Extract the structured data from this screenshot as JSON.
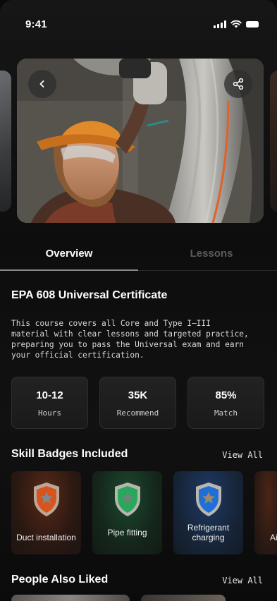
{
  "status_bar": {
    "time": "9:41"
  },
  "hero": {
    "back_icon": "chevron-left-icon",
    "share_icon": "share-icon"
  },
  "tabs": [
    {
      "label": "Overview",
      "active": true
    },
    {
      "label": "Lessons",
      "active": false
    }
  ],
  "course": {
    "title": "EPA 608 Universal Certificate",
    "description": "This course covers all Core and Type I–III material with clear lessons and targeted practice, preparing you to pass the Universal exam and earn your official certification."
  },
  "stats": [
    {
      "value": "10-12",
      "label": "Hours"
    },
    {
      "value": "35K",
      "label": "Recommend"
    },
    {
      "value": "85%",
      "label": "Match"
    }
  ],
  "skill_badges": {
    "title": "Skill Badges Included",
    "view_all": "View All",
    "items": [
      {
        "label": "Duct installation",
        "color": "#d9541c"
      },
      {
        "label": "Pipe fitting",
        "color": "#27a85a"
      },
      {
        "label": "Refrigerant charging",
        "color": "#1f6fd8"
      },
      {
        "label": "Ai",
        "color": "#c2571c"
      }
    ]
  },
  "people_also_liked": {
    "title": "People Also Liked",
    "view_all": "View All"
  }
}
